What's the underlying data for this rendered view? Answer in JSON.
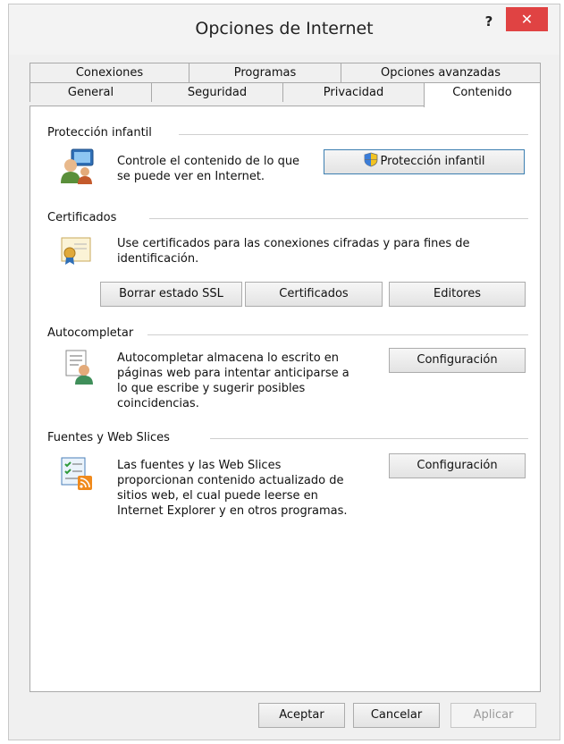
{
  "window": {
    "title": "Opciones de Internet",
    "help_label": "?",
    "close_label": "✕"
  },
  "tabs": {
    "row1": [
      "Conexiones",
      "Programas",
      "Opciones avanzadas"
    ],
    "row2": [
      "General",
      "Seguridad",
      "Privacidad",
      "Contenido"
    ],
    "active": "Contenido"
  },
  "proteccion": {
    "title": "Protección infantil",
    "description_lines": [
      "Controle el contenido de lo que",
      "se puede ver en Internet."
    ],
    "button_label": "Protección infantil"
  },
  "certificados": {
    "title": "Certificados",
    "description_lines": [
      "Use certificados para las conexiones cifradas y para fines de",
      "identificación."
    ],
    "buttons": [
      "Borrar estado SSL",
      "Certificados",
      "Editores"
    ]
  },
  "autocompletar": {
    "title": "Autocompletar",
    "description_lines": [
      "Autocompletar almacena lo escrito en",
      "páginas web para intentar anticiparse a",
      "lo que escribe y sugerir posibles",
      "coincidencias."
    ],
    "button_label": "Configuración"
  },
  "fuentes": {
    "title": "Fuentes y Web Slices",
    "description_lines": [
      "Las fuentes y las Web Slices",
      "proporcionan contenido actualizado de",
      "sitios web, el cual puede leerse en",
      "Internet Explorer y en otros programas."
    ],
    "button_label": "Configuración"
  },
  "footer": {
    "ok_label": "Aceptar",
    "cancel_label": "Cancelar",
    "apply_label": "Aplicar"
  },
  "icons": {
    "proteccion": "family-safety-icon",
    "certificados": "certificate-icon",
    "autocompletar": "autocomplete-icon",
    "fuentes": "feeds-icon",
    "shield": "uac-shield-icon"
  },
  "colors": {
    "close_button": "#e04343",
    "primary_border": "#3c7fb1"
  }
}
